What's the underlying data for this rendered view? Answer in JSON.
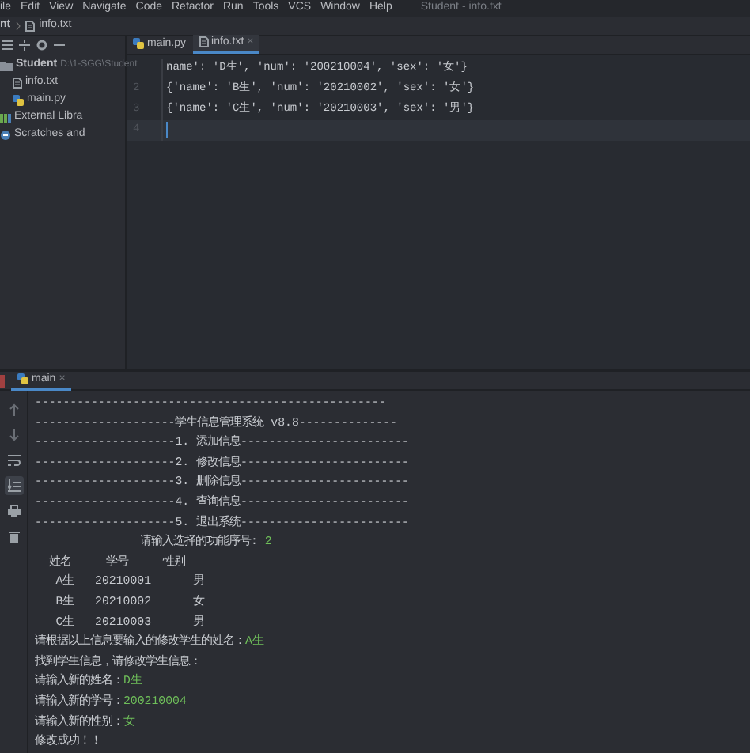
{
  "menu_bar": {
    "items": [
      "ile",
      "Edit",
      "View",
      "Navigate",
      "Code",
      "Refactor",
      "Run",
      "Tools",
      "VCS",
      "Window",
      "Help"
    ],
    "title": "Student - info.txt"
  },
  "breadcrumb": {
    "items": [
      "nt",
      "info.txt"
    ]
  },
  "editor_tabs": [
    {
      "label": "main.py",
      "kind": "python",
      "selected": false
    },
    {
      "label": "info.txt",
      "kind": "text",
      "selected": true,
      "close": "×"
    }
  ],
  "project_tree": [
    {
      "label": "Student",
      "path": "D:\\1-SGG\\Student",
      "kind": "folder",
      "children": [
        {
          "label": "info.txt",
          "kind": "text"
        },
        {
          "label": "main.py",
          "kind": "python"
        }
      ]
    },
    {
      "label": "External Libra",
      "kind": "library"
    },
    {
      "label": "Scratches and",
      "kind": "scratch"
    }
  ],
  "editor": {
    "lines": [
      {
        "text": "name': 'D生', 'num': '200210004', 'sex': '女'}",
        "current": false
      },
      {
        "number": "2",
        "text": "{'name': 'B生', 'num': '20210002', 'sex': '女'}",
        "current": false
      },
      {
        "number": "3",
        "text": "{'name': 'C生', 'num': '20210003', 'sex': '男'}",
        "current": false
      },
      {
        "number": "4",
        "current": true
      }
    ]
  },
  "run_panel": {
    "tab": {
      "label": "main",
      "close": "×"
    },
    "tools": [
      {
        "kind": "up",
        "selected": false
      },
      {
        "kind": "down",
        "selected": false
      },
      {
        "kind": "wrap",
        "selected": false
      },
      {
        "kind": "scroll",
        "selected": true
      },
      {
        "kind": "print",
        "selected": false
      },
      {
        "kind": "trash",
        "selected": false
      }
    ],
    "console": [
      {
        "text": "--------------------------------------------------"
      },
      {
        "text": "--------------------学生信息管理系统 v8.8--------------"
      },
      {
        "text": "--------------------1. 添加信息------------------------"
      },
      {
        "text": "--------------------2. 修改信息------------------------"
      },
      {
        "text": "--------------------3. 删除信息------------------------"
      },
      {
        "text": "--------------------4. 查询信息------------------------"
      },
      {
        "text": "--------------------5. 退出系统------------------------"
      },
      {
        "text": "               请输入选择的功能序号: ",
        "input": "2"
      },
      {
        "text": "  姓名     学号     性别"
      },
      {
        "text": "   A生   20210001      男"
      },
      {
        "text": "   B生   20210002      女"
      },
      {
        "text": "   C生   20210003      男"
      },
      {
        "text": "请根据以上信息要输入的修改学生的姓名：",
        "input": "A生"
      },
      {
        "text": "找到学生信息，请修改学生信息："
      },
      {
        "text": "请输入新的姓名：",
        "input": "D生"
      },
      {
        "text": "请输入新的学号：",
        "input": "200210004"
      },
      {
        "text": "请输入新的性别：",
        "input": "女"
      },
      {
        "text": "修改成功！！"
      }
    ]
  }
}
